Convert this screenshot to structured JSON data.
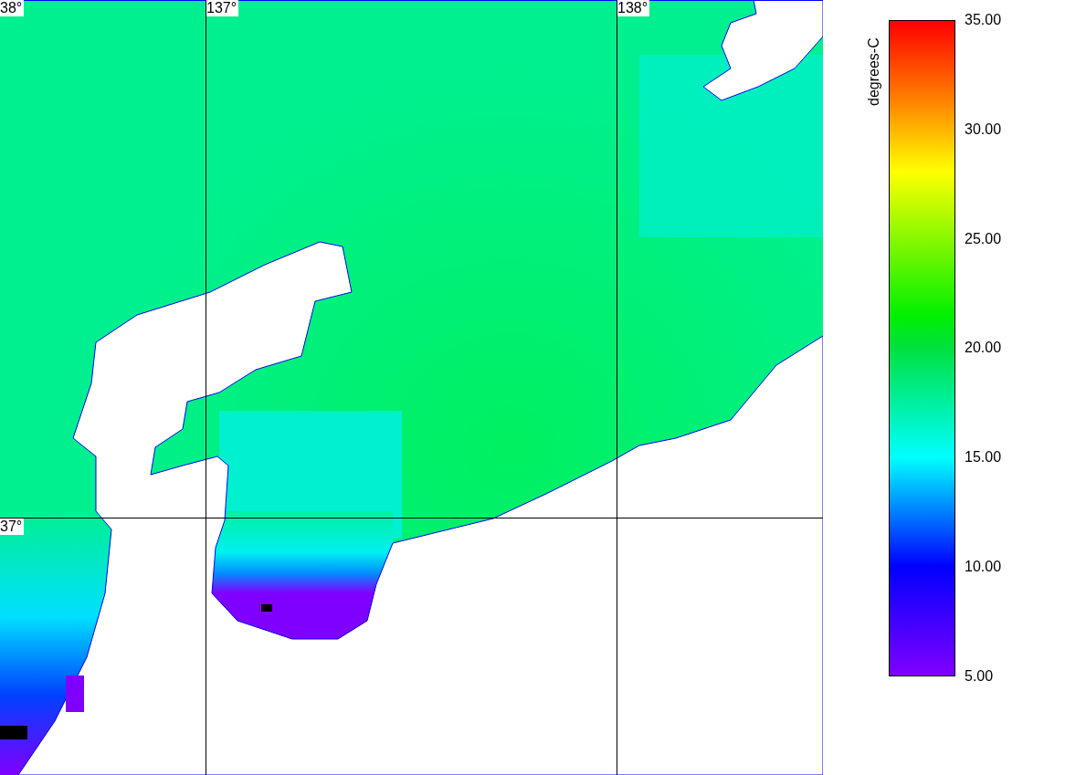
{
  "map": {
    "latitude_labels": [
      "38°",
      "37°"
    ],
    "longitude_labels": [
      "137°",
      "138°"
    ]
  },
  "colorbar": {
    "title": "degrees-C",
    "ticks": [
      "35.00",
      "30.00",
      "25.00",
      "20.00",
      "15.00",
      "10.00",
      "5.00"
    ]
  }
}
